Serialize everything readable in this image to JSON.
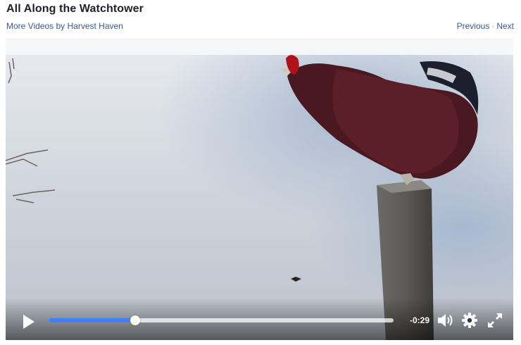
{
  "header": {
    "title": "All Along the Watchtower",
    "more_videos": "More Videos by Harvest Haven",
    "previous": "Previous",
    "separator": "·",
    "next": "Next"
  },
  "player": {
    "time_remaining": "-0:29",
    "progress_fraction": 0.25,
    "controls": {
      "play_icon": "play-icon",
      "volume_icon": "volume-icon",
      "settings_icon": "gear-icon",
      "fullscreen_icon": "fullscreen-icon"
    }
  },
  "colors": {
    "title": "#1d2129",
    "link": "#365899",
    "progress": "#4080ff"
  }
}
